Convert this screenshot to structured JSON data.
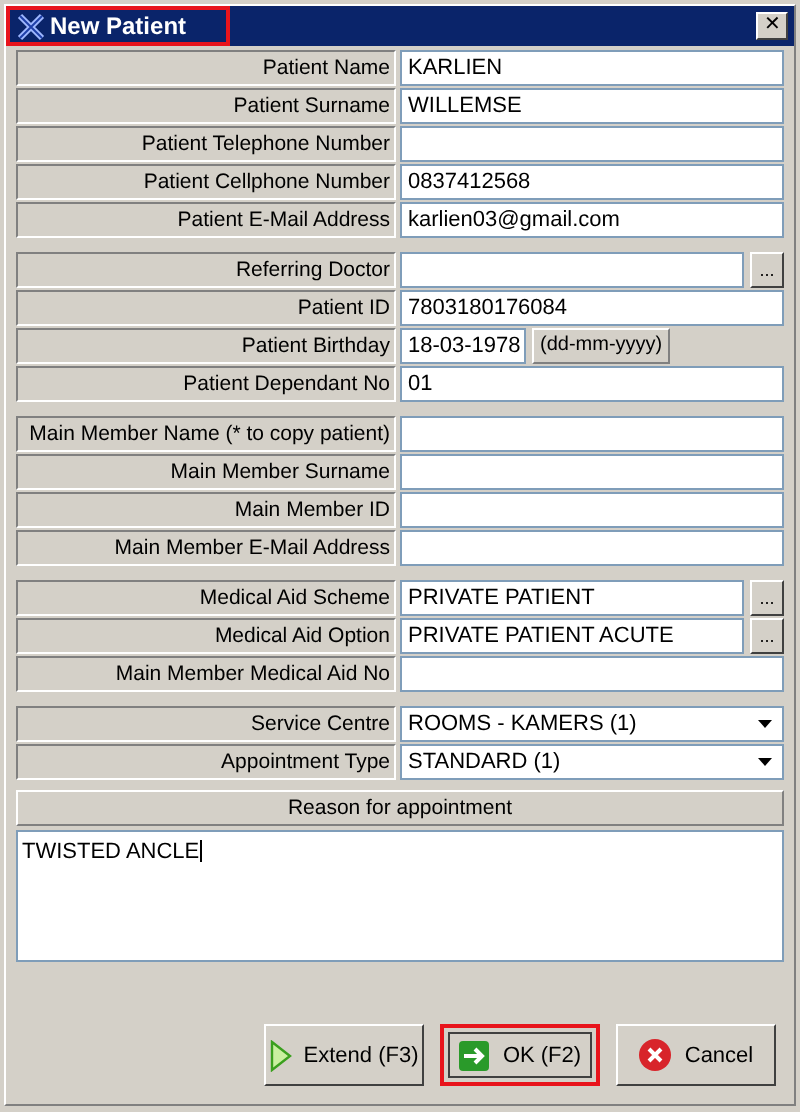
{
  "window": {
    "title": "New Patient",
    "highlighted": true,
    "close": "✕"
  },
  "groups": [
    {
      "rows": [
        {
          "label": "Patient Name",
          "value": "KARLIEN",
          "kind": "text"
        },
        {
          "label": "Patient Surname",
          "value": "WILLEMSE",
          "kind": "text"
        },
        {
          "label": "Patient Telephone Number",
          "kind": "text"
        },
        {
          "label": "Patient Cellphone Number",
          "value": "0837412568",
          "kind": "text"
        },
        {
          "label": "Patient E-Mail Address",
          "value": "karlien03@gmail.com",
          "kind": "text"
        }
      ]
    },
    {
      "rows": [
        {
          "label": "Referring Doctor",
          "kind": "lookup",
          "button": "..."
        },
        {
          "label": "Patient ID",
          "value": "7803180176084",
          "kind": "text"
        },
        {
          "label": "Patient Birthday",
          "value": "18-03-1978",
          "kind": "date",
          "hint": "(dd-mm-yyyy)"
        },
        {
          "label": "Patient Dependant No",
          "value": "01",
          "kind": "text"
        }
      ]
    },
    {
      "rows": [
        {
          "label": "Main Member Name (* to copy patient)",
          "kind": "text"
        },
        {
          "label": "Main Member Surname",
          "kind": "text"
        },
        {
          "label": "Main Member ID",
          "kind": "text"
        },
        {
          "label": "Main Member E-Mail Address",
          "kind": "text"
        }
      ]
    },
    {
      "rows": [
        {
          "label": "Medical Aid Scheme",
          "value": "PRIVATE PATIENT",
          "kind": "lookup",
          "button": "..."
        },
        {
          "label": "Medical Aid Option",
          "value": "PRIVATE PATIENT ACUTE",
          "kind": "lookup",
          "button": "..."
        },
        {
          "label": "Main Member Medical Aid No",
          "kind": "text"
        }
      ]
    },
    {
      "rows": [
        {
          "label": "Service Centre",
          "value": "ROOMS - KAMERS (1)",
          "kind": "select"
        },
        {
          "label": "Appointment Type",
          "value": "STANDARD (1)",
          "kind": "select"
        }
      ]
    }
  ],
  "reason": {
    "heading": "Reason for appointment",
    "value": "TWISTED ANCLE"
  },
  "buttons": [
    {
      "label": "Extend (F3)",
      "kind": "extend",
      "highlighted": false
    },
    {
      "label": "OK (F2)",
      "kind": "ok",
      "highlighted": true
    },
    {
      "label": "Cancel",
      "kind": "cancel",
      "highlighted": false
    }
  ]
}
